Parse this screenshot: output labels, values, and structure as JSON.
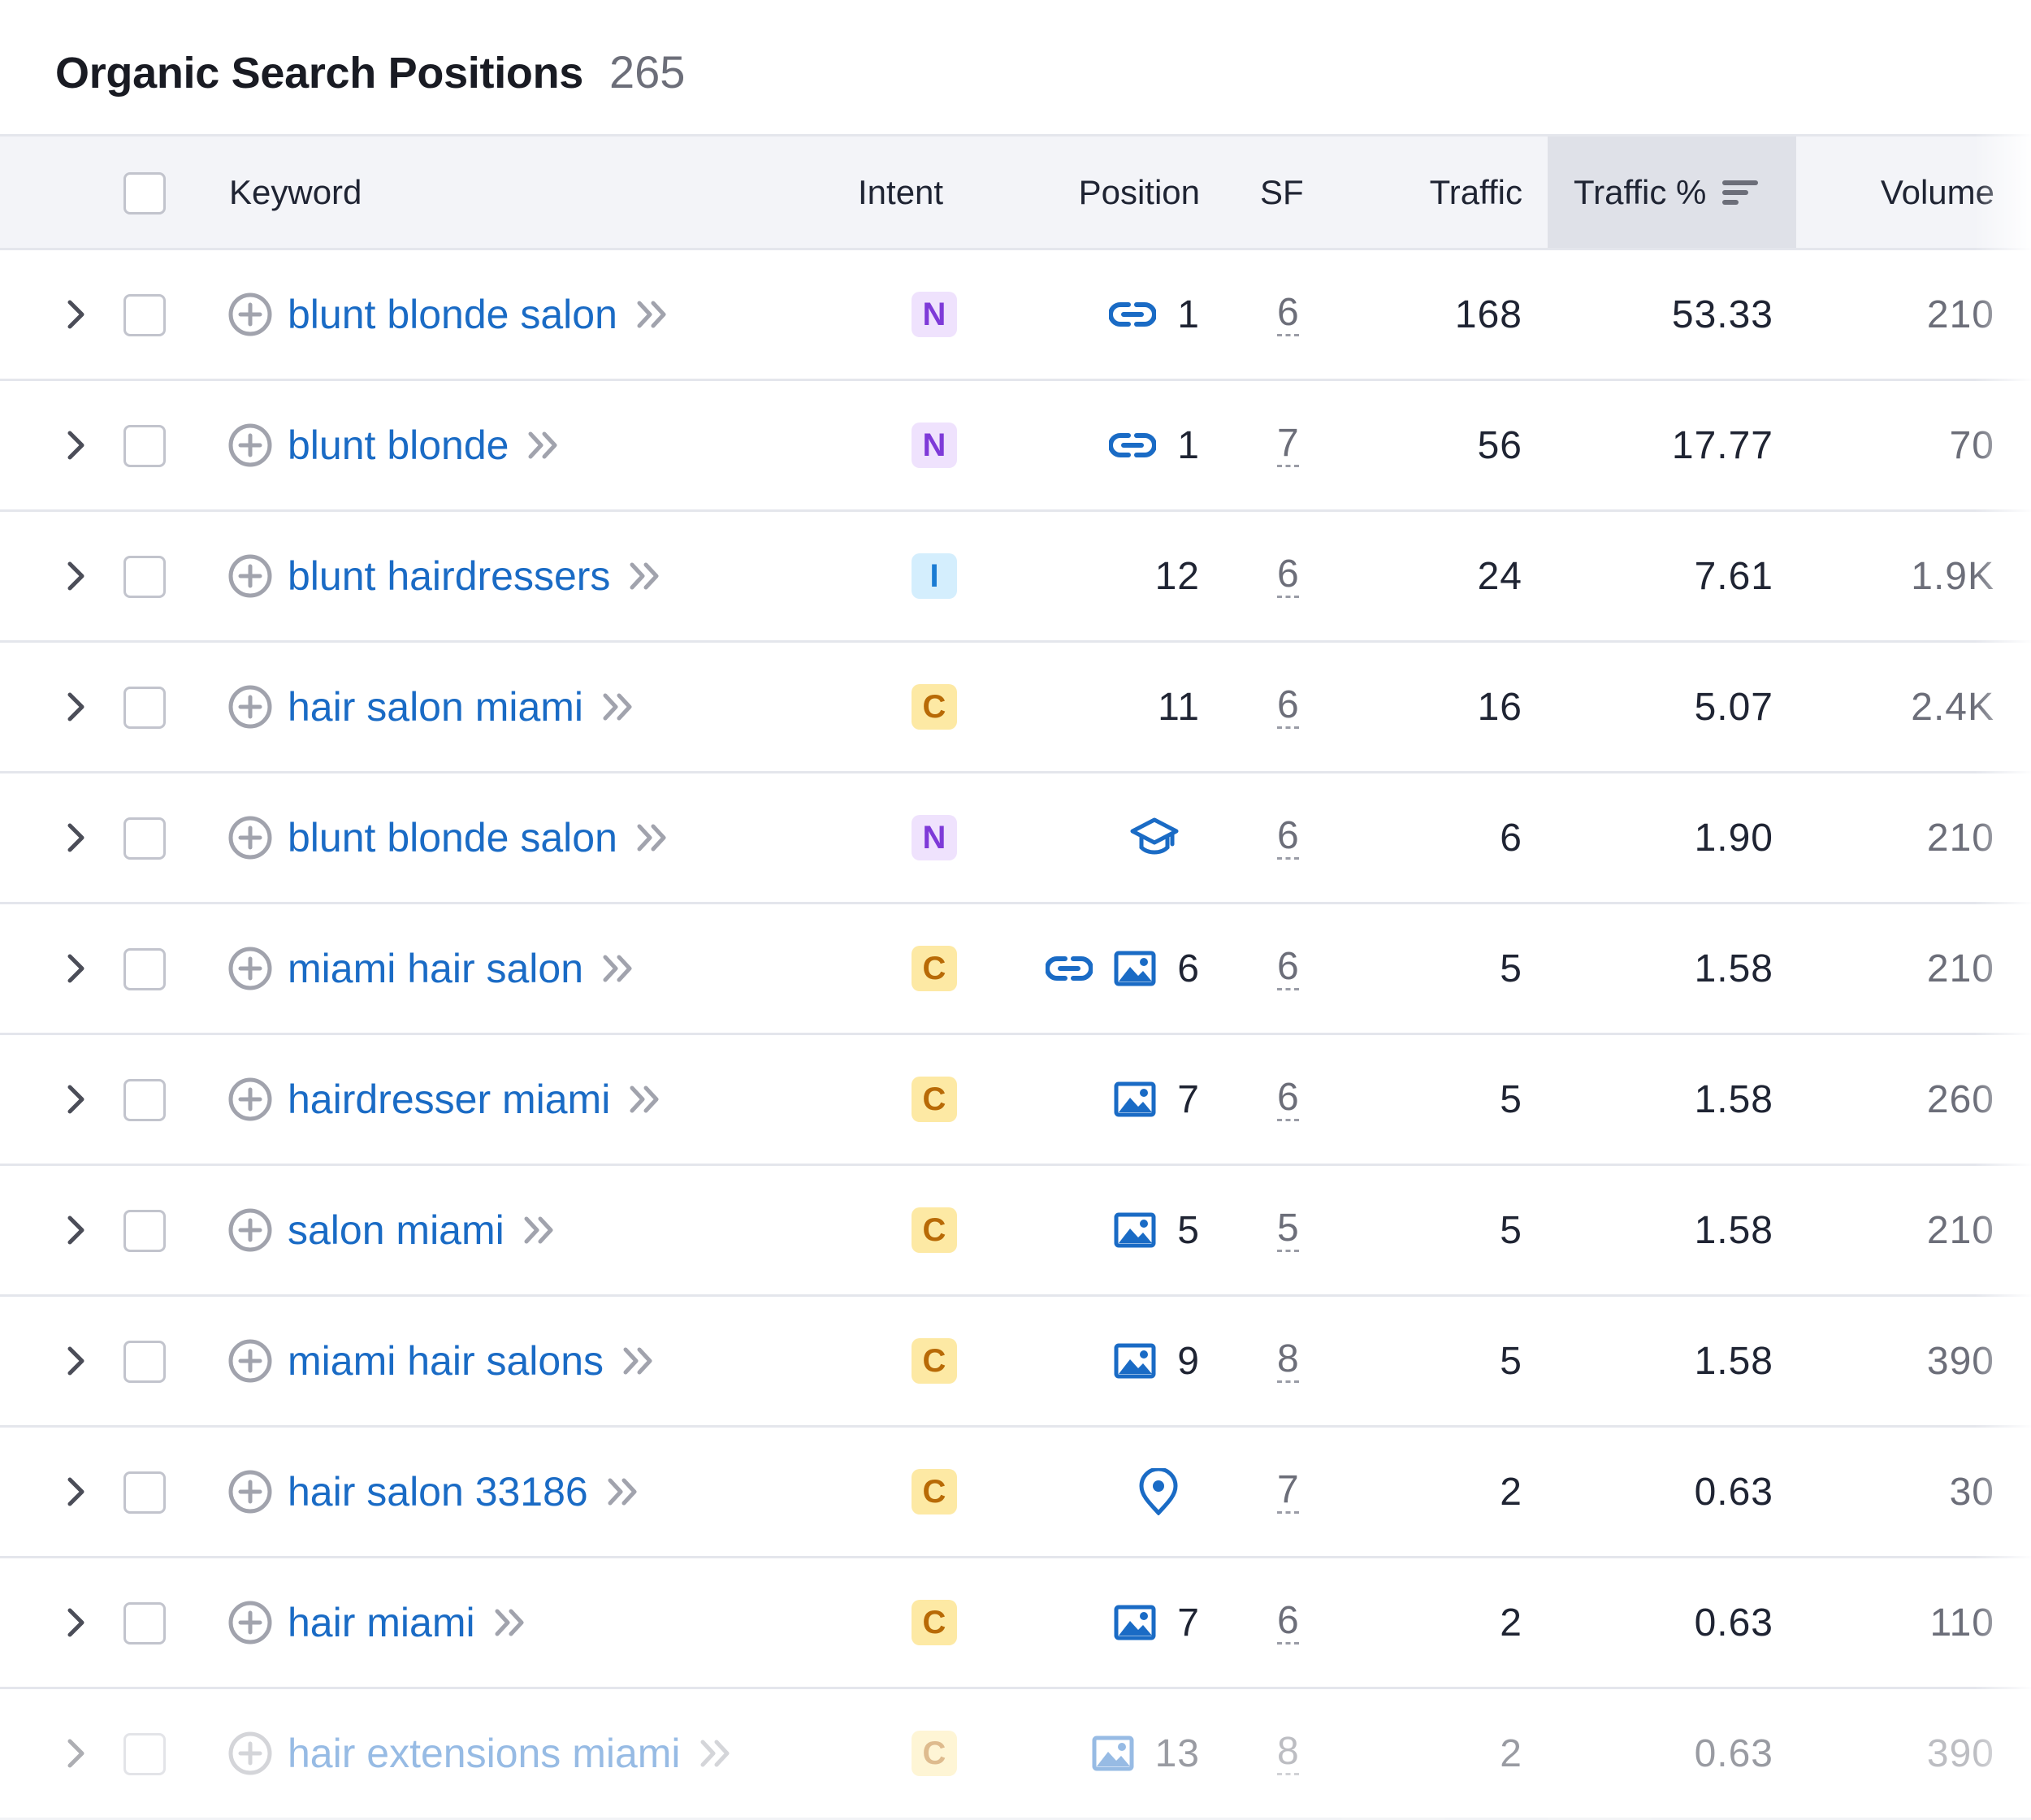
{
  "header": {
    "title": "Organic Search Positions",
    "count": "265"
  },
  "columns": {
    "keyword": "Keyword",
    "intent": "Intent",
    "position": "Position",
    "sf": "SF",
    "traffic": "Traffic",
    "traffic_pct": "Traffic %",
    "volume": "Volume"
  },
  "intent_colors": {
    "N": {
      "bg": "#efe2fd",
      "fg": "#7e3ad8"
    },
    "I": {
      "bg": "#d4eefd",
      "fg": "#1a7bd3"
    },
    "C": {
      "bg": "#fde9a4",
      "fg": "#b86a06"
    }
  },
  "rows": [
    {
      "keyword": "blunt blonde salon",
      "intent": "N",
      "features": [
        "link-icon"
      ],
      "position": "1",
      "sf": "6",
      "traffic": "168",
      "traffic_pct": "53.33",
      "volume": "210"
    },
    {
      "keyword": "blunt blonde",
      "intent": "N",
      "features": [
        "link-icon"
      ],
      "position": "1",
      "sf": "7",
      "traffic": "56",
      "traffic_pct": "17.77",
      "volume": "70"
    },
    {
      "keyword": "blunt hairdressers",
      "intent": "I",
      "features": [],
      "position": "12",
      "sf": "6",
      "traffic": "24",
      "traffic_pct": "7.61",
      "volume": "1.9K"
    },
    {
      "keyword": "hair salon miami",
      "intent": "C",
      "features": [],
      "position": "11",
      "sf": "6",
      "traffic": "16",
      "traffic_pct": "5.07",
      "volume": "2.4K"
    },
    {
      "keyword": "blunt blonde salon",
      "intent": "N",
      "features": [
        "graduation-cap-icon"
      ],
      "position": "",
      "sf": "6",
      "traffic": "6",
      "traffic_pct": "1.90",
      "volume": "210"
    },
    {
      "keyword": "miami hair salon",
      "intent": "C",
      "features": [
        "link-icon",
        "image-icon"
      ],
      "position": "6",
      "sf": "6",
      "traffic": "5",
      "traffic_pct": "1.58",
      "volume": "210"
    },
    {
      "keyword": "hairdresser miami",
      "intent": "C",
      "features": [
        "image-icon"
      ],
      "position": "7",
      "sf": "6",
      "traffic": "5",
      "traffic_pct": "1.58",
      "volume": "260"
    },
    {
      "keyword": "salon miami",
      "intent": "C",
      "features": [
        "image-icon"
      ],
      "position": "5",
      "sf": "5",
      "traffic": "5",
      "traffic_pct": "1.58",
      "volume": "210"
    },
    {
      "keyword": "miami hair salons",
      "intent": "C",
      "features": [
        "image-icon"
      ],
      "position": "9",
      "sf": "8",
      "traffic": "5",
      "traffic_pct": "1.58",
      "volume": "390"
    },
    {
      "keyword": "hair salon 33186",
      "intent": "C",
      "features": [
        "map-pin-icon"
      ],
      "position": "",
      "sf": "7",
      "traffic": "2",
      "traffic_pct": "0.63",
      "volume": "30"
    },
    {
      "keyword": "hair miami",
      "intent": "C",
      "features": [
        "image-icon"
      ],
      "position": "7",
      "sf": "6",
      "traffic": "2",
      "traffic_pct": "0.63",
      "volume": "110"
    },
    {
      "keyword": "hair extensions miami",
      "intent": "C",
      "features": [
        "image-icon"
      ],
      "position": "13",
      "sf": "8",
      "traffic": "2",
      "traffic_pct": "0.63",
      "volume": "390",
      "faded": true
    }
  ],
  "accent_color": "#1a6bc5"
}
